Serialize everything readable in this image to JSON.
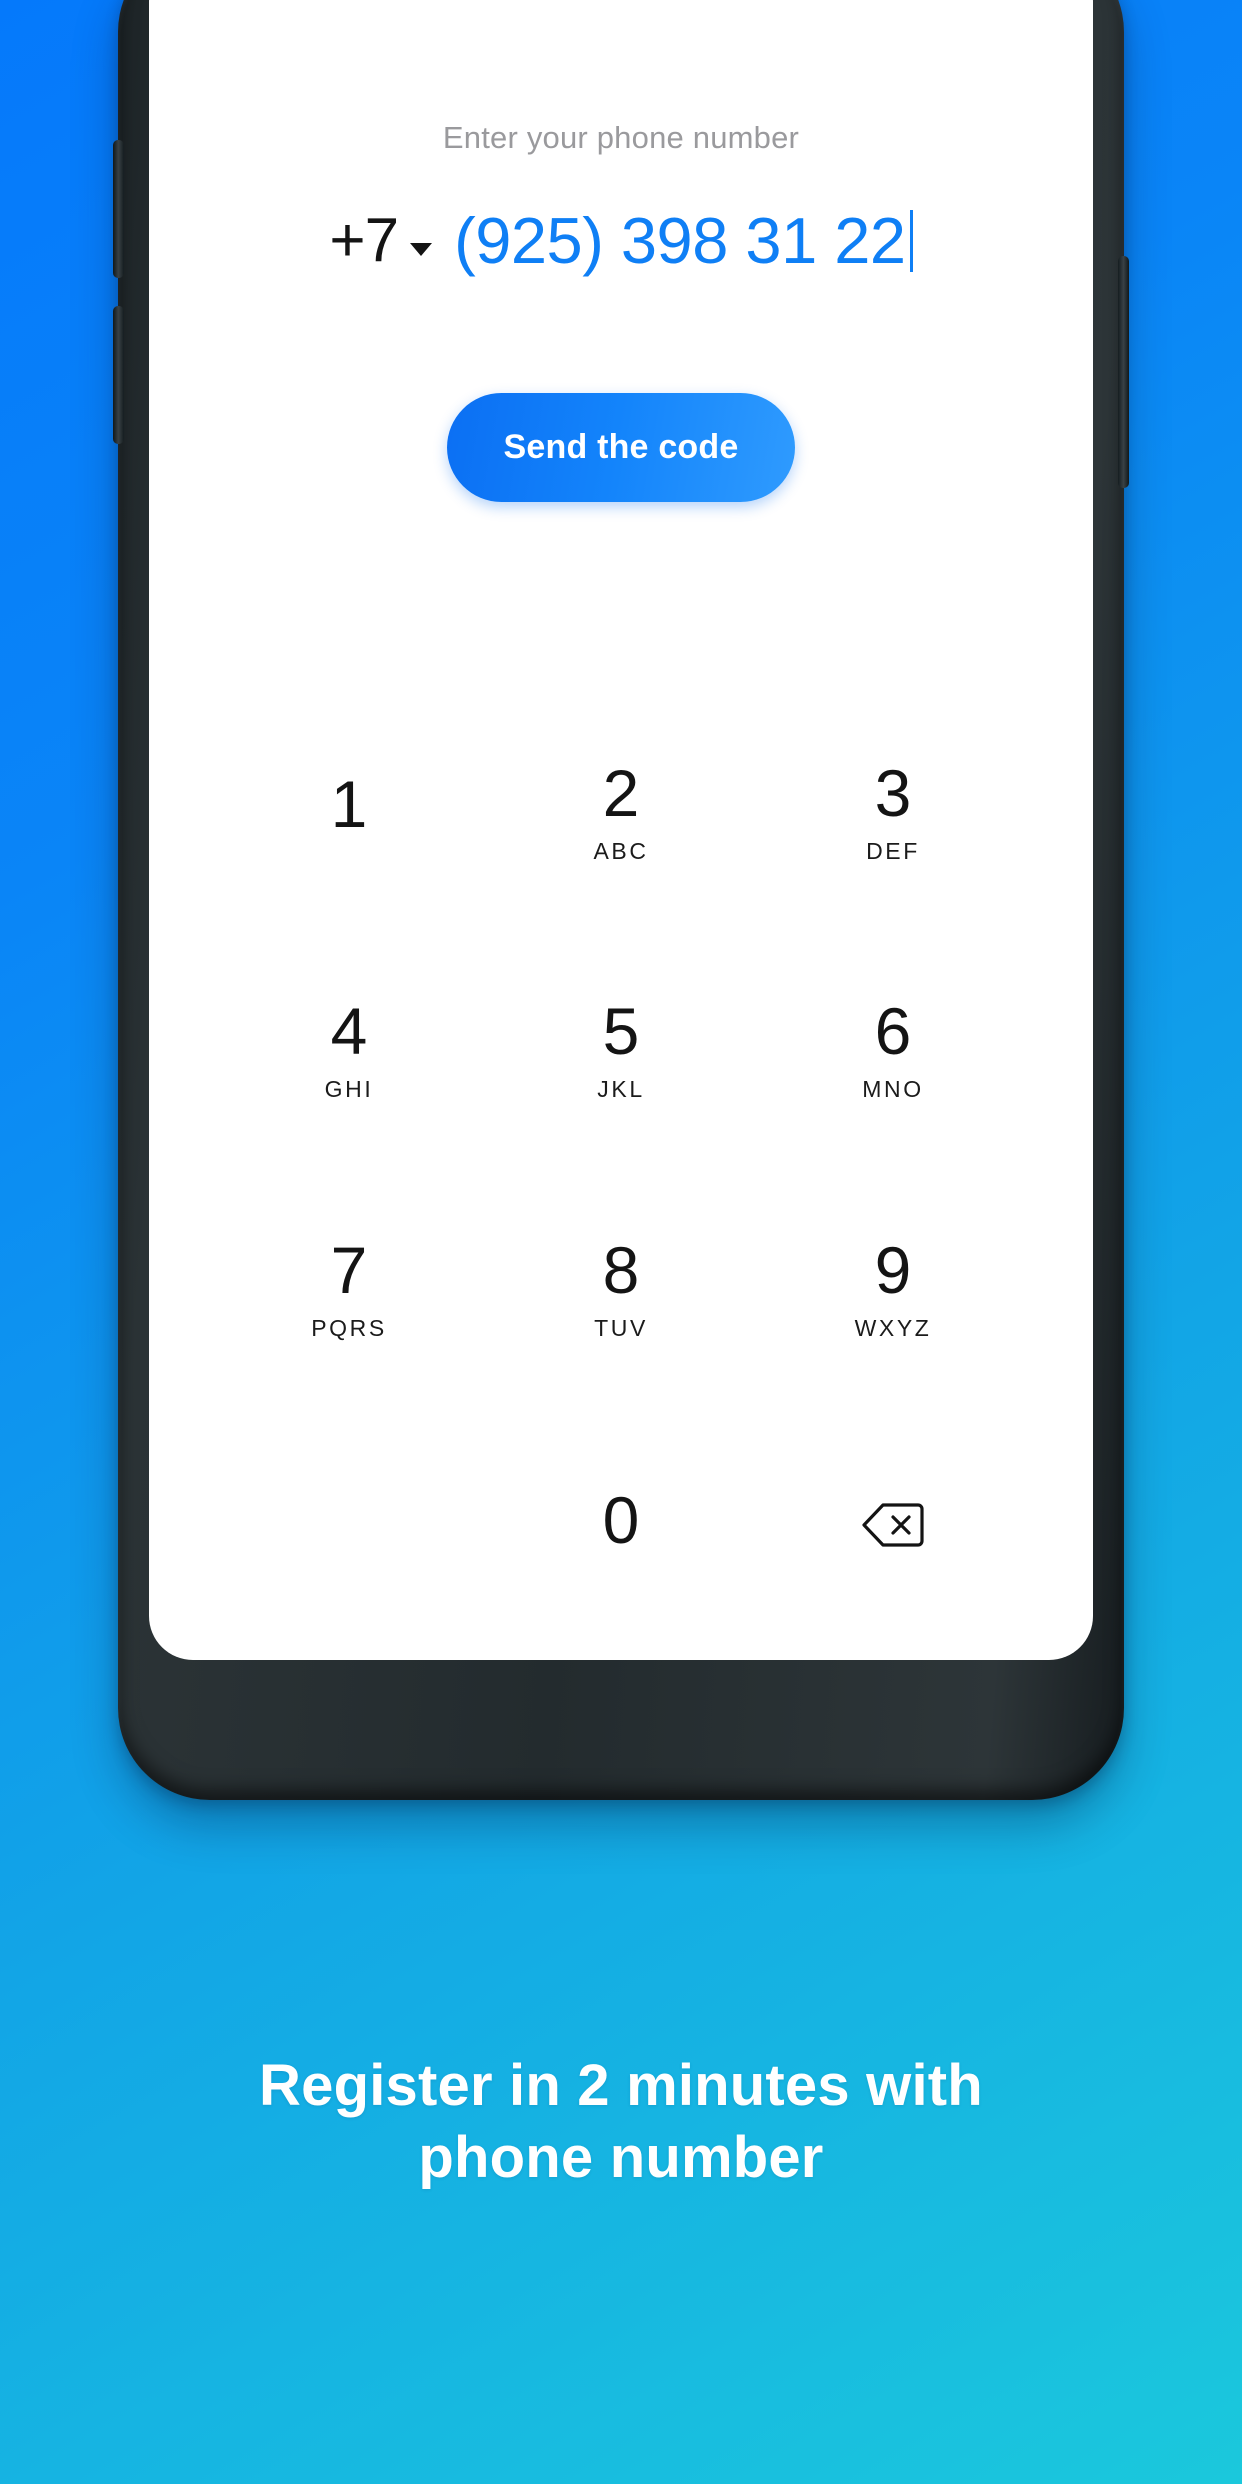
{
  "background": {
    "gradient_from": "#0579fb",
    "gradient_to": "#1bc8dc"
  },
  "phone_screen": {
    "hint": "Enter your phone number",
    "country_code": "+7",
    "country_code_icon": "chevron-down-icon",
    "phone_number": "(925) 398 31 22",
    "phone_number_color": "#0f7ff5",
    "send_button": {
      "label": "Send the code",
      "color_from": "#0b6ff3",
      "color_to": "#2f9bfe"
    },
    "keypad": {
      "keys": [
        {
          "digit": "1",
          "letters": ""
        },
        {
          "digit": "2",
          "letters": "ABC"
        },
        {
          "digit": "3",
          "letters": "DEF"
        },
        {
          "digit": "4",
          "letters": "GHI"
        },
        {
          "digit": "5",
          "letters": "JKL"
        },
        {
          "digit": "6",
          "letters": "MNO"
        },
        {
          "digit": "7",
          "letters": "PQRS"
        },
        {
          "digit": "8",
          "letters": "TUV"
        },
        {
          "digit": "9",
          "letters": "WXYZ"
        },
        {
          "digit": "0",
          "letters": ""
        }
      ],
      "backspace_icon": "backspace-icon"
    }
  },
  "caption": {
    "line1": "Register in 2 minutes with",
    "line2": "phone number"
  }
}
